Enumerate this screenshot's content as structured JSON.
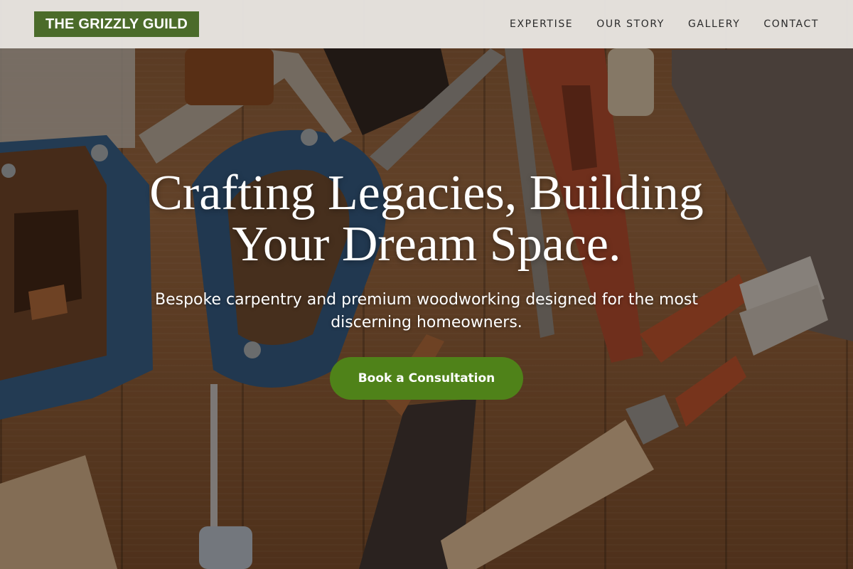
{
  "brand": {
    "logo_text": "THE GRIZZLY GUILD",
    "color": "#4b6b2a"
  },
  "nav": {
    "items": [
      {
        "label": "EXPERTISE"
      },
      {
        "label": "OUR STORY"
      },
      {
        "label": "GALLERY"
      },
      {
        "label": "CONTACT"
      }
    ]
  },
  "hero": {
    "headline": "Crafting Legacies, Building Your Dream Space.",
    "subheadline": "Bespoke carpentry and premium woodworking designed for the most discerning homeowners.",
    "cta_label": "Book a Consultation",
    "cta_color": "#4f8219",
    "background": {
      "description_icon": "wood-tools-background",
      "tool_icons": [
        "hand-saw-icon",
        "coping-saw-icon",
        "chisel-icon",
        "pliers-icon",
        "screwdriver-icon",
        "file-icon",
        "hammer-handle-icon"
      ]
    }
  }
}
